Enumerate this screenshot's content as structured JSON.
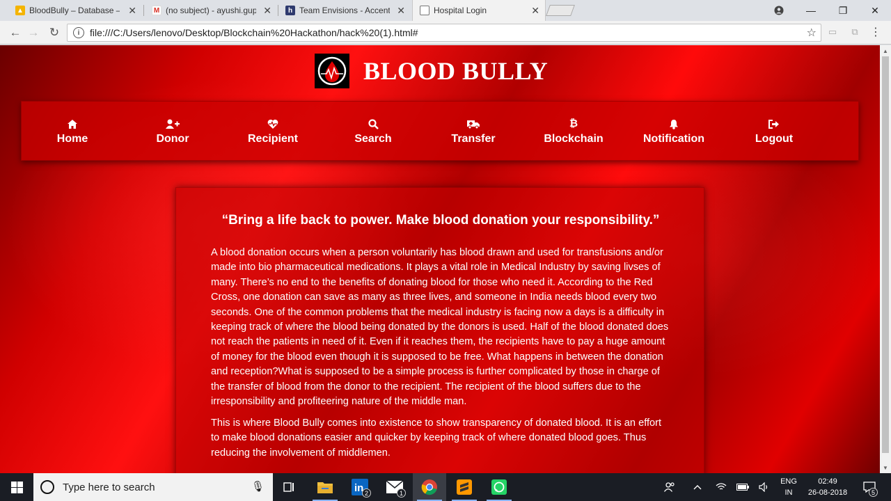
{
  "browser": {
    "tabs": [
      {
        "title": "BloodBully – Database –",
        "favicon": "blood-bully-favicon"
      },
      {
        "title": "(no subject) - ayushi.gup",
        "favicon": "gmail-favicon"
      },
      {
        "title": "Team Envisions - Accentu",
        "favicon": "hackerearth-favicon"
      },
      {
        "title": "Hospital Login",
        "favicon": "document-favicon",
        "active": true
      }
    ],
    "url": "file:///C:/Users/lenovo/Desktop/Blockchain%20Hackathon/hack%20(1).html#"
  },
  "site": {
    "brand_name": "BLOOD BULLY",
    "nav": [
      {
        "label": "Home",
        "icon": "home-icon"
      },
      {
        "label": "Donor",
        "icon": "add-user-icon"
      },
      {
        "label": "Recipient",
        "icon": "heartbeat-icon"
      },
      {
        "label": "Search",
        "icon": "search-icon"
      },
      {
        "label": "Transfer",
        "icon": "ambulance-icon"
      },
      {
        "label": "Blockchain",
        "icon": "bitcoin-icon"
      },
      {
        "label": "Notification",
        "icon": "bell-icon"
      },
      {
        "label": "Logout",
        "icon": "sign-out-icon"
      }
    ],
    "quote": "“Bring a life back to power. Make blood donation your responsibility.”",
    "paragraphs": [
      "A blood donation occurs when a person voluntarily has blood drawn and used for transfusions and/or made into bio pharmaceutical medications. It plays a vital role in Medical Industry by saving livses of many. There’s no end to the benefits of donating blood for those who need it. According to the Red Cross, one donation can save as many as three lives, and someone in India needs blood every two seconds. One of the common problems that the medical industry is facing now a days is a difficulty in keeping track of where the blood being donated by the donors is used. Half of the blood donated does not reach the patients in need of it. Even if it reaches them, the recipients have to pay a huge amount of money for the blood even though it is supposed to be free. What happens in between the donation and reception?What is supposed to be a simple process is further complicated by those in charge of the transfer of blood from the donor to the recipient. The recipient of the blood suffers due to the irresponsibility and profiteering nature of the middle man.",
      "This is where Blood Bully comes into existence to show transparency of donated blood. It is an effort to make blood donations easier and quicker by keeping track of where donated blood goes. Thus reducing the involvement of middlemen."
    ],
    "colors": {
      "primary": "#e00000",
      "dark": "#700000",
      "text": "#ffffff"
    }
  },
  "taskbar": {
    "search_placeholder": "Type here to search",
    "linkedin_badge": "2",
    "mail_badge": "1",
    "lang_line1": "ENG",
    "lang_line2": "IN",
    "time": "02:49",
    "date": "26-08-2018",
    "notification_count": "5"
  }
}
